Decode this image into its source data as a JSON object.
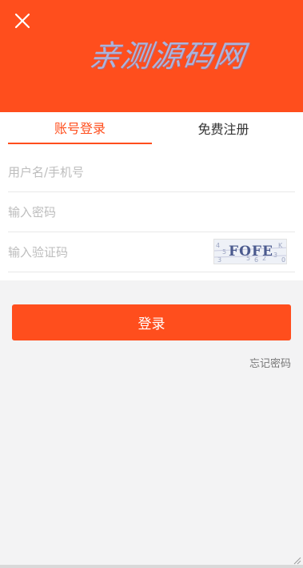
{
  "header": {
    "logo_text": "亲测源码网",
    "close_icon": "close-icon"
  },
  "tabs": [
    {
      "label": "账号登录",
      "active": true
    },
    {
      "label": "免费注册",
      "active": false
    }
  ],
  "form": {
    "username_placeholder": "用户名/手机号",
    "password_placeholder": "输入密码",
    "captcha_placeholder": "输入验证码",
    "captcha_text": "FOFE"
  },
  "login_button": "登录",
  "forgot_password": "忘记密码",
  "colors": {
    "brand": "#ff4e1d",
    "background": "#f3f3f4",
    "logo": "#a9b4de"
  }
}
